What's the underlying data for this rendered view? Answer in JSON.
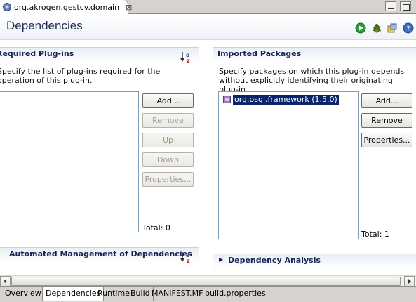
{
  "editor_tab": {
    "title": "org.akrogen.gestcv.domain",
    "close_glyph": "⊠"
  },
  "header": {
    "title": "Dependencies",
    "icons": [
      "run-icon",
      "debug-icon",
      "export-icon",
      "help-icon"
    ]
  },
  "required_plugins": {
    "title": "Required Plug-ins",
    "description": "Specify the list of plug-ins required for the operation of this plug-in.",
    "items": [],
    "buttons": {
      "add": "Add...",
      "remove": "Remove",
      "up": "Up",
      "down": "Down",
      "properties": "Properties..."
    },
    "total": "Total: 0"
  },
  "imported_packages": {
    "title": "Imported Packages",
    "description": "Specify packages on which this plug-in depends without explicitly identifying their originating plug-in.",
    "items": [
      {
        "label": "org.osgi.framework (1.5.0)",
        "selected": true
      }
    ],
    "buttons": {
      "add": "Add...",
      "remove": "Remove",
      "properties": "Properties..."
    },
    "total": "Total: 1"
  },
  "automated_management": {
    "title": "Automated Management of Dependencies"
  },
  "dependency_analysis": {
    "title": "Dependency Analysis",
    "expand_glyph": "▶"
  },
  "page_tabs": [
    {
      "label": "Overview",
      "active": false
    },
    {
      "label": "Dependencies",
      "active": true
    },
    {
      "label": "Runtime",
      "active": false
    },
    {
      "label": "Build",
      "active": false
    },
    {
      "label": "MANIFEST.MF",
      "active": false
    },
    {
      "label": "build.properties",
      "active": false
    }
  ],
  "colors": {
    "section_title": "#142454",
    "form_title": "#1e2e57",
    "selection": "#0a246a",
    "list_border": "#7f9db9"
  }
}
